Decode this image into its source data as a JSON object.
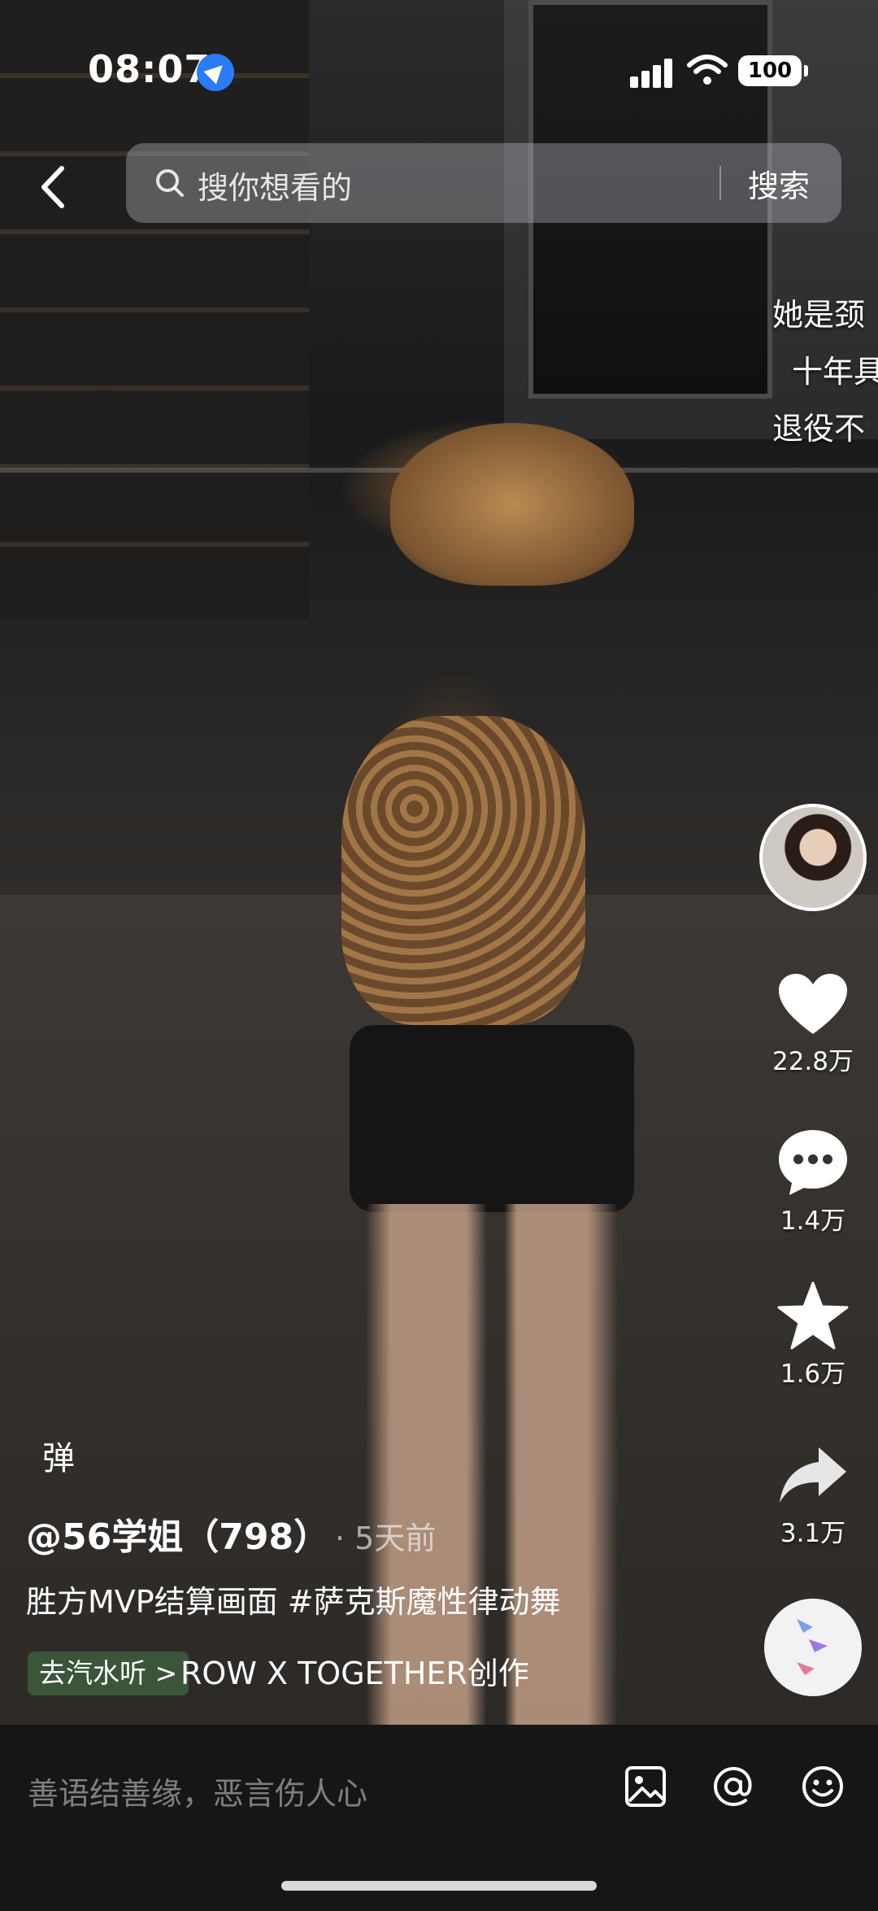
{
  "status_bar": {
    "time": "08:07",
    "battery": "100",
    "icons": [
      "location-arrow-icon",
      "cell-signal-icon",
      "wifi-icon",
      "battery-icon"
    ]
  },
  "search": {
    "placeholder": "搜你想看的",
    "button_label": "搜索"
  },
  "overlay_text": [
    "她是颈",
    "十年具",
    "退役不"
  ],
  "actions": {
    "like_count": "22.8万",
    "comment_count": "1.4万",
    "favorite_count": "1.6万",
    "share_count": "3.1万"
  },
  "post": {
    "danmu_label": "弹",
    "author": "@56学姐（798）",
    "time_ago": "· 5天前",
    "description": "胜方MVP结算画面 #萨克斯魔性律动舞",
    "music_tag": "去汽水听 >",
    "music_title": "ROW X TOGETHER创作"
  },
  "comment_bar": {
    "placeholder": "善语结善缘，恶言伤人心",
    "icons": [
      "image-icon",
      "at-icon",
      "emoji-icon"
    ]
  },
  "colors": {
    "accent_blue": "#2a7cf7",
    "comment_bar_bg": "#161616",
    "music_tag_bg": "#3c5a3c"
  }
}
